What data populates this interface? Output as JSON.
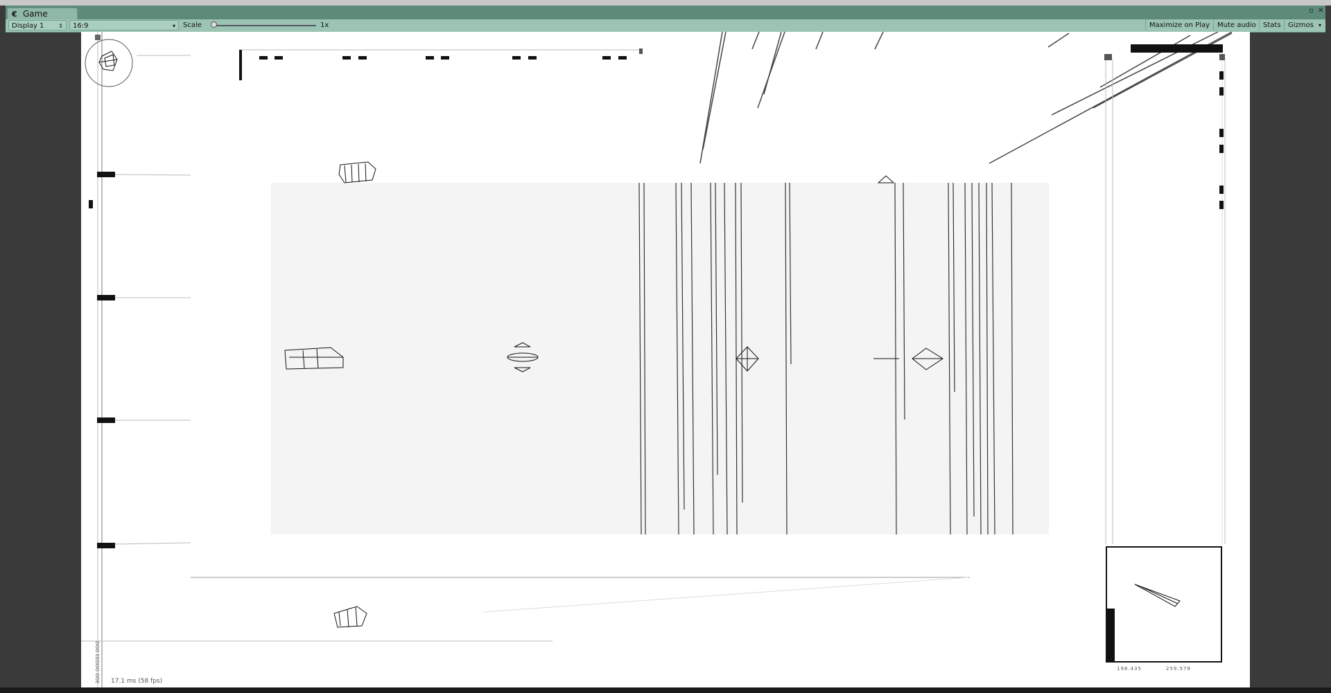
{
  "window": {
    "tab_label": "Game",
    "tab_icon": "unity-game-icon",
    "controls": [
      "maximize-icon",
      "close-icon",
      "menu-icon"
    ]
  },
  "toolbar": {
    "display_label": "Display 1",
    "aspect_label": "16:9",
    "scale_label": "Scale",
    "scale_value": "1x",
    "maximize_on_play": "Maximize on Play",
    "mute_audio": "Mute audio",
    "stats": "Stats",
    "gizmos": "Gizmos"
  },
  "game": {
    "fps_text": "17.1 ms (58 fps)",
    "vertical_readout": "DOO EEDOO ODE",
    "minimap_readouts": [
      "198.435",
      "259.578"
    ]
  },
  "colors": {
    "editor_bg": "#3a3a3a",
    "tab_bar": "#5e8a7a",
    "toolbar": "#9cc4b3",
    "viewport": "#ffffff"
  }
}
